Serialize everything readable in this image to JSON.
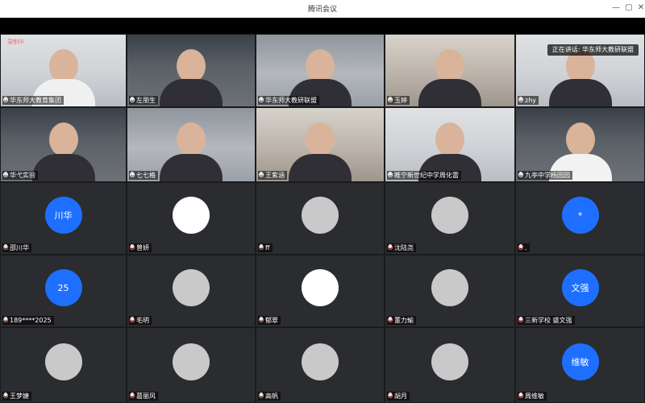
{
  "window": {
    "title": "腾讯会议"
  },
  "speaking": {
    "text": "正在讲话: 华东师大教研联盟"
  },
  "recording": {
    "text": "录制中"
  },
  "tiles": [
    {
      "name": "华东师大教育集团",
      "kind": "video"
    },
    {
      "name": "左朋生",
      "kind": "video"
    },
    {
      "name": "华东师大教研联盟",
      "kind": "video"
    },
    {
      "name": "玉婷",
      "kind": "video"
    },
    {
      "name": "zhy",
      "kind": "video"
    },
    {
      "name": "华弋实验",
      "kind": "video"
    },
    {
      "name": "七七格",
      "kind": "video"
    },
    {
      "name": "王紫涵",
      "kind": "video"
    },
    {
      "name": "睢宁新世纪中学周化雷",
      "kind": "video"
    },
    {
      "name": "九亭中学杨园园",
      "kind": "video"
    },
    {
      "name": "邵川华",
      "kind": "avatar",
      "avatar_text": "川华",
      "avatar_style": "blue"
    },
    {
      "name": "曾妍",
      "kind": "avatar",
      "avatar_text": "",
      "avatar_style": "white"
    },
    {
      "name": "ff",
      "kind": "avatar",
      "avatar_text": "",
      "avatar_style": "photo"
    },
    {
      "name": "沈陆尧",
      "kind": "avatar",
      "avatar_text": "",
      "avatar_style": "photo"
    },
    {
      "name": ".",
      "kind": "avatar",
      "avatar_text": "*",
      "avatar_style": "blue"
    },
    {
      "name": "189****2025",
      "kind": "avatar",
      "avatar_text": "25",
      "avatar_style": "blue"
    },
    {
      "name": "毛明",
      "kind": "avatar",
      "avatar_text": "",
      "avatar_style": "photo"
    },
    {
      "name": "郁翠",
      "kind": "avatar",
      "avatar_text": "",
      "avatar_style": "white"
    },
    {
      "name": "董力瑜",
      "kind": "avatar",
      "avatar_text": "",
      "avatar_style": "photo"
    },
    {
      "name": "三新学校 盛文强",
      "kind": "avatar",
      "avatar_text": "文强",
      "avatar_style": "blue"
    },
    {
      "name": "王梦婕",
      "kind": "avatar",
      "avatar_text": "",
      "avatar_style": "photo"
    },
    {
      "name": "葛丽风",
      "kind": "avatar",
      "avatar_text": "",
      "avatar_style": "photo"
    },
    {
      "name": "高帆",
      "kind": "avatar",
      "avatar_text": "",
      "avatar_style": "photo"
    },
    {
      "name": "胡月",
      "kind": "avatar",
      "avatar_text": "",
      "avatar_style": "photo"
    },
    {
      "name": "周维敏",
      "kind": "avatar",
      "avatar_text": "维敏",
      "avatar_style": "blue"
    }
  ],
  "icons": {
    "minimize": "minimize-icon",
    "restore": "restore-icon",
    "close": "close-icon",
    "mic": "mic-icon"
  }
}
